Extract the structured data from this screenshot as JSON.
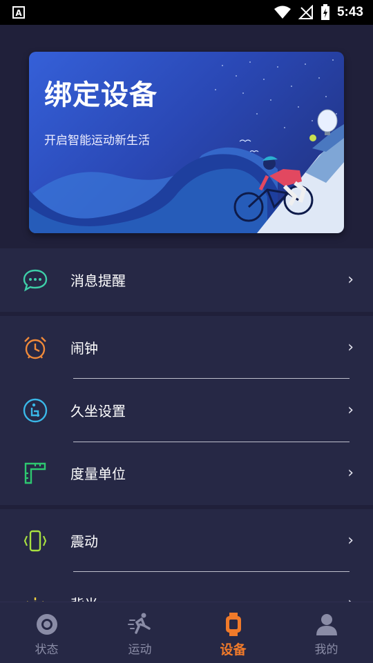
{
  "status_bar": {
    "time": "5:43"
  },
  "banner": {
    "title": "绑定设备",
    "subtitle": "开启智能运动新生活"
  },
  "menu": {
    "message_reminder": "消息提醒",
    "alarm": "闹钟",
    "sedentary": "久坐设置",
    "units": "度量单位",
    "vibration": "震动",
    "backlight": "背光",
    "chevron": "›"
  },
  "tabs": [
    {
      "label": "状态",
      "icon": "status-icon"
    },
    {
      "label": "运动",
      "icon": "running-icon"
    },
    {
      "label": "设备",
      "icon": "watch-icon",
      "active": true
    },
    {
      "label": "我的",
      "icon": "person-icon"
    }
  ],
  "colors": {
    "accent": "#f07a2a",
    "background": "#20203a",
    "panel": "#262845",
    "message_icon": "#3ecfa8",
    "alarm_icon": "#f08a3a",
    "sedentary_icon": "#3ab8e8",
    "units_icon": "#2ec870",
    "vibration_icon": "#a8e040"
  }
}
